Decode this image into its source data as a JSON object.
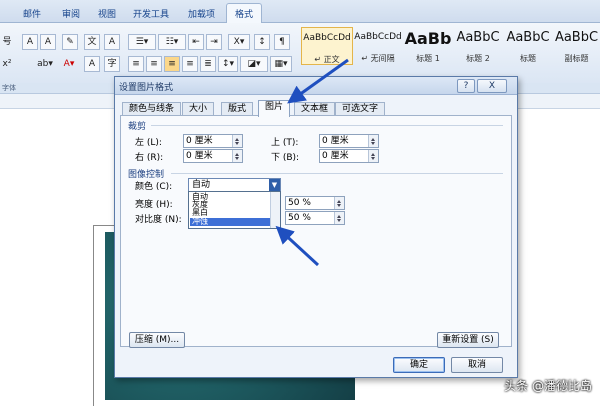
{
  "ribbon": {
    "tabs": [
      "邮件",
      "审阅",
      "视图",
      "开发工具",
      "加载项",
      "格式"
    ],
    "active_tab": "格式",
    "font_size_fragment": "号",
    "style_gallery": [
      {
        "preview": "AaBbCcDd",
        "name": "↵ 正文"
      },
      {
        "preview": "AaBbCcDd",
        "name": "↵ 无间隔"
      },
      {
        "preview": "AaBb",
        "name": "标题 1"
      },
      {
        "preview": "AaBbC",
        "name": "标题 2"
      },
      {
        "preview": "AaBbC",
        "name": "标题"
      },
      {
        "preview": "AaBbC",
        "name": "副标题"
      }
    ],
    "group_label_fragment": "字体"
  },
  "dialog": {
    "title": "设置图片格式",
    "help_label": "?",
    "close_label": "X",
    "tabs": [
      "颜色与线条",
      "大小",
      "版式",
      "图片",
      "文本框",
      "可选文字"
    ],
    "active_tab": "图片",
    "crop": {
      "section_label": "裁剪",
      "left": {
        "label": "左 (L):",
        "value": "0 厘米"
      },
      "right": {
        "label": "右 (R):",
        "value": "0 厘米"
      },
      "top": {
        "label": "上 (T):",
        "value": "0 厘米"
      },
      "bottom": {
        "label": "下 (B):",
        "value": "0 厘米"
      }
    },
    "image_control": {
      "section_label": "图像控制",
      "color_label": "颜色 (C):",
      "color_value": "自动",
      "color_options": [
        "自动",
        "灰度",
        "黑白",
        "冲蚀"
      ],
      "highlighted_option": "冲蚀",
      "brightness_label": "亮度 (H):",
      "brightness_value": "50 %",
      "contrast_label": "对比度 (N):",
      "contrast_value": "50 %"
    },
    "compress_button": "压缩 (M)...",
    "reset_button": "重新设置 (S)",
    "ok_button": "确定",
    "cancel_button": "取消"
  },
  "watermark": "头条 @潘德比岛",
  "colors": {
    "accent_arrow": "#1f4fbf",
    "highlight": "#3d6fd6",
    "document_image": "#1f5f64"
  }
}
